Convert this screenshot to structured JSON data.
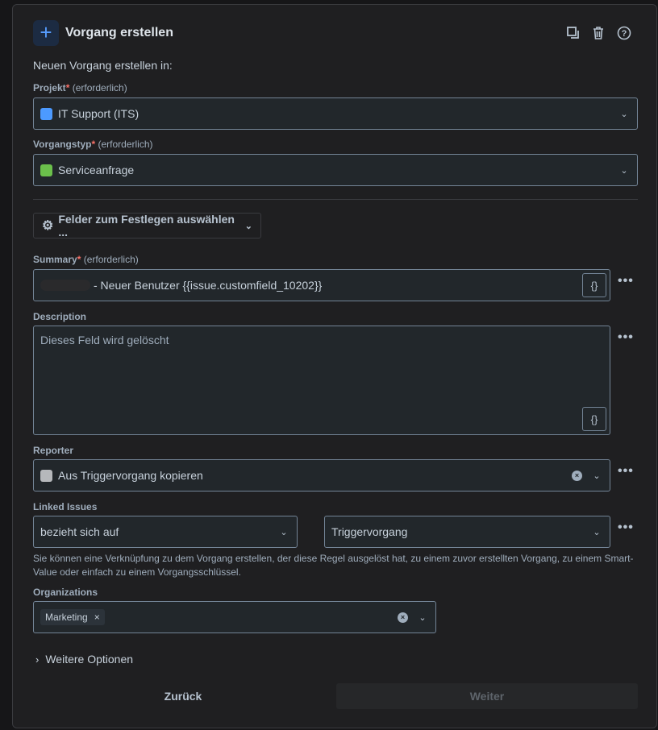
{
  "header": {
    "title": "Vorgang erstellen",
    "icon": "plus-icon"
  },
  "intro": "Neuen Vorgang erstellen in:",
  "project": {
    "label": "Projekt",
    "required_mark": "*",
    "required_text": "(erforderlich)",
    "value": "IT Support (ITS)",
    "icon_color": "#4c9aff"
  },
  "issue_type": {
    "label": "Vorgangstyp",
    "required_mark": "*",
    "required_text": "(erforderlich)",
    "value": "Serviceanfrage",
    "icon_color": "#6bc04b"
  },
  "fields_button": "Felder zum Festlegen auswählen ...",
  "summary": {
    "label": "Summary",
    "required_mark": "*",
    "required_text": "(erforderlich)",
    "value": "- Neuer Benutzer {{issue.customfield_10202}}",
    "smart_value": "{}"
  },
  "description": {
    "label": "Description",
    "value": "Dieses Feld wird gelöscht",
    "smart_value": "{}"
  },
  "reporter": {
    "label": "Reporter",
    "value": "Aus Triggervorgang kopieren"
  },
  "linked_issues": {
    "label": "Linked Issues",
    "link_type": "bezieht sich auf",
    "target": "Triggervorgang",
    "help": "Sie können eine Verknüpfung zu dem Vorgang erstellen, der diese Regel ausgelöst hat, zu einem zuvor erstellten Vorgang, zu einem Smart-Value oder einfach zu einem Vorgangsschlüssel."
  },
  "organizations": {
    "label": "Organizations",
    "tags": [
      "Marketing"
    ]
  },
  "more_options": "Weitere Optionen",
  "more_menu": "•••",
  "buttons": {
    "back": "Zurück",
    "next": "Weiter"
  }
}
